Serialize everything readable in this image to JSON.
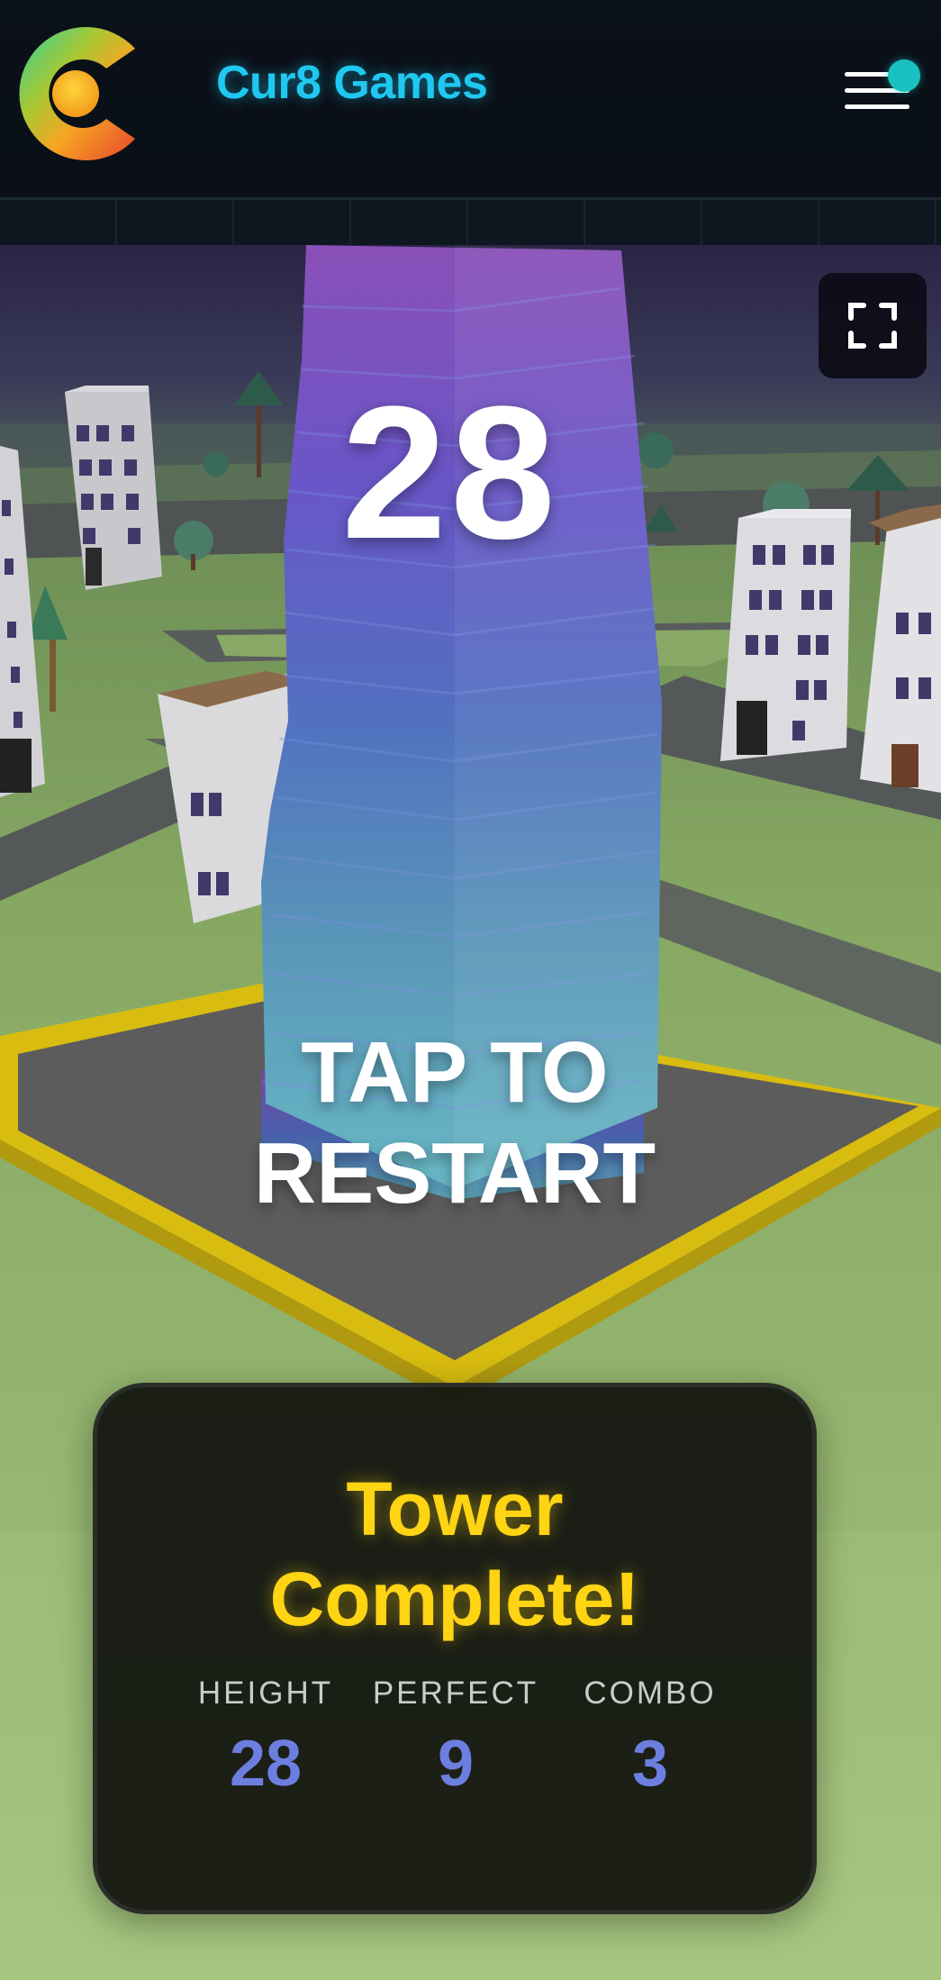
{
  "header": {
    "brand": "Cur8 Games",
    "menu_icon": "hamburger-menu-icon",
    "notification_color": "#19c2c0",
    "brand_color": "#1fc8f0"
  },
  "game": {
    "score": "28",
    "restart_label": "TAP TO\nRESTART",
    "fullscreen_icon": "fullscreen-icon"
  },
  "result": {
    "title": "Tower\nComplete!",
    "title_color": "#ffd413",
    "value_color": "#6c7fe0",
    "stats": [
      {
        "label": "HEIGHT",
        "value": "28"
      },
      {
        "label": "PERFECT",
        "value": "9"
      },
      {
        "label": "COMBO",
        "value": "3"
      }
    ]
  }
}
